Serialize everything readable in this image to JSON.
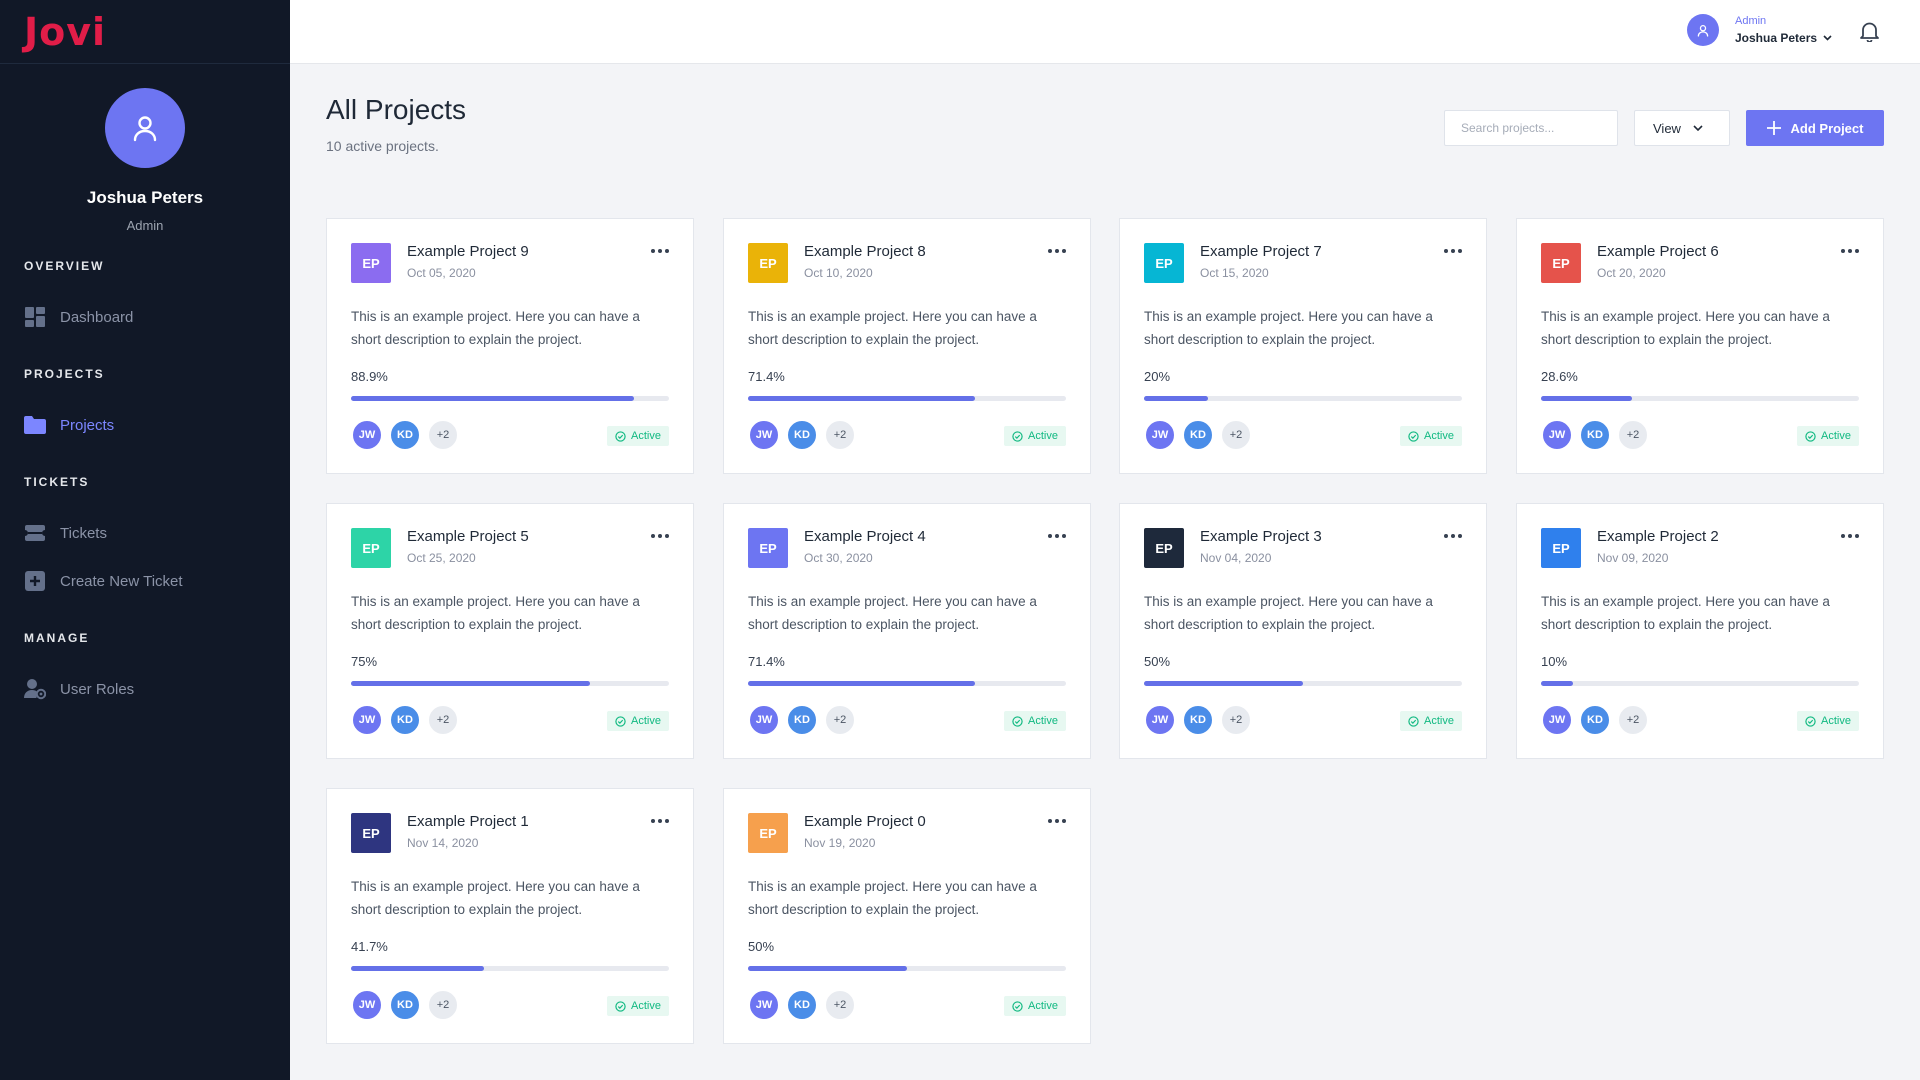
{
  "app": {
    "logo": "Jovi"
  },
  "sidebar": {
    "profile": {
      "name": "Joshua Peters",
      "role": "Admin"
    },
    "sections": [
      {
        "heading": "OVERVIEW",
        "items": [
          {
            "label": "Dashboard",
            "icon": "dashboard-icon"
          }
        ]
      },
      {
        "heading": "PROJECTS",
        "items": [
          {
            "label": "Projects",
            "icon": "folder-icon",
            "active": true
          }
        ]
      },
      {
        "heading": "TICKETS",
        "items": [
          {
            "label": "Tickets",
            "icon": "ticket-icon"
          },
          {
            "label": "Create New Ticket",
            "icon": "plus-square-icon"
          }
        ]
      },
      {
        "heading": "MANAGE",
        "items": [
          {
            "label": "User Roles",
            "icon": "user-roles-icon"
          }
        ]
      }
    ]
  },
  "topbar": {
    "user_role": "Admin",
    "user_name": "Joshua Peters"
  },
  "header": {
    "title": "All Projects",
    "subtitle": "10 active projects.",
    "search_placeholder": "Search projects...",
    "view_label": "View",
    "add_label": "Add Project"
  },
  "colors": {
    "accent": "#6d75f2",
    "sidebar_bg": "#111827",
    "logo": "#e11d48",
    "status_active": "#10b981"
  },
  "projects": [
    {
      "initials": "EP",
      "title": "Example Project 9",
      "date": "Oct 05, 2020",
      "desc": "This is an example project. Here you can have a short description to explain the project.",
      "progress_label": "88.9%",
      "progress": 88.9,
      "color": "#8b6cf0",
      "members": [
        "JW",
        "KD",
        "+2"
      ],
      "status": "Active"
    },
    {
      "initials": "EP",
      "title": "Example Project 8",
      "date": "Oct 10, 2020",
      "desc": "This is an example project. Here you can have a short description to explain the project.",
      "progress_label": "71.4%",
      "progress": 71.4,
      "color": "#eab308",
      "members": [
        "JW",
        "KD",
        "+2"
      ],
      "status": "Active"
    },
    {
      "initials": "EP",
      "title": "Example Project 7",
      "date": "Oct 15, 2020",
      "desc": "This is an example project. Here you can have a short description to explain the project.",
      "progress_label": "20%",
      "progress": 20,
      "color": "#06b6d4",
      "members": [
        "JW",
        "KD",
        "+2"
      ],
      "status": "Active"
    },
    {
      "initials": "EP",
      "title": "Example Project 6",
      "date": "Oct 20, 2020",
      "desc": "This is an example project. Here you can have a short description to explain the project.",
      "progress_label": "28.6%",
      "progress": 28.6,
      "color": "#e5534b",
      "members": [
        "JW",
        "KD",
        "+2"
      ],
      "status": "Active"
    },
    {
      "initials": "EP",
      "title": "Example Project 5",
      "date": "Oct 25, 2020",
      "desc": "This is an example project. Here you can have a short description to explain the project.",
      "progress_label": "75%",
      "progress": 75,
      "color": "#2dd4a7",
      "members": [
        "JW",
        "KD",
        "+2"
      ],
      "status": "Active"
    },
    {
      "initials": "EP",
      "title": "Example Project 4",
      "date": "Oct 30, 2020",
      "desc": "This is an example project. Here you can have a short description to explain the project.",
      "progress_label": "71.4%",
      "progress": 71.4,
      "color": "#6d75f2",
      "members": [
        "JW",
        "KD",
        "+2"
      ],
      "status": "Active"
    },
    {
      "initials": "EP",
      "title": "Example Project 3",
      "date": "Nov 04, 2020",
      "desc": "This is an example project. Here you can have a short description to explain the project.",
      "progress_label": "50%",
      "progress": 50,
      "color": "#1e293b",
      "members": [
        "JW",
        "KD",
        "+2"
      ],
      "status": "Active"
    },
    {
      "initials": "EP",
      "title": "Example Project 2",
      "date": "Nov 09, 2020",
      "desc": "This is an example project. Here you can have a short description to explain the project.",
      "progress_label": "10%",
      "progress": 10,
      "color": "#2f80ed",
      "members": [
        "JW",
        "KD",
        "+2"
      ],
      "status": "Active"
    },
    {
      "initials": "EP",
      "title": "Example Project 1",
      "date": "Nov 14, 2020",
      "desc": "This is an example project. Here you can have a short description to explain the project.",
      "progress_label": "41.7%",
      "progress": 41.7,
      "color": "#2e3580",
      "members": [
        "JW",
        "KD",
        "+2"
      ],
      "status": "Active"
    },
    {
      "initials": "EP",
      "title": "Example Project 0",
      "date": "Nov 19, 2020",
      "desc": "This is an example project. Here you can have a short description to explain the project.",
      "progress_label": "50%",
      "progress": 50,
      "color": "#f6a04d",
      "members": [
        "JW",
        "KD",
        "+2"
      ],
      "status": "Active"
    }
  ]
}
